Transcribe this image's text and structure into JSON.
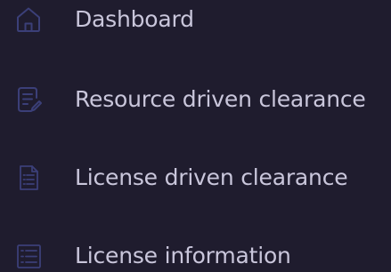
{
  "sidebar": {
    "items": [
      {
        "label": "Dashboard",
        "icon": "home-icon"
      },
      {
        "label": "Resource driven clearance",
        "icon": "document-edit-icon"
      },
      {
        "label": "License driven clearance",
        "icon": "document-lines-icon"
      },
      {
        "label": "License information",
        "icon": "list-icon"
      }
    ]
  },
  "colors": {
    "background": "#1f1c2e",
    "text": "#c9c6db",
    "icon": "#3b3f78"
  }
}
